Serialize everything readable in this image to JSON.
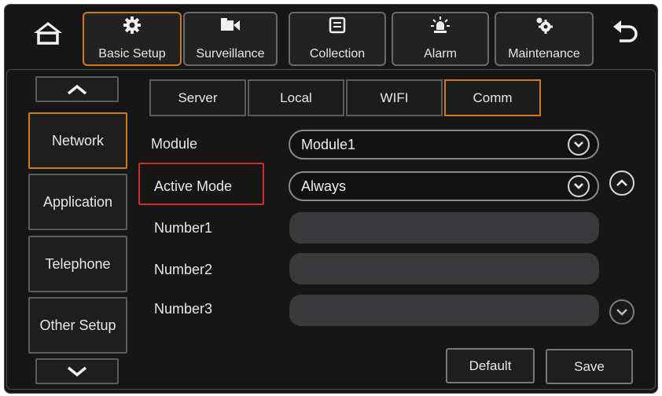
{
  "topbar": {
    "items": [
      {
        "label": "Basic Setup",
        "icon": "gear-icon",
        "active": true
      },
      {
        "label": "Surveillance",
        "icon": "camera-icon",
        "active": false
      },
      {
        "label": "Collection",
        "icon": "collection-icon",
        "active": false
      },
      {
        "label": "Alarm",
        "icon": "alarm-icon",
        "active": false
      },
      {
        "label": "Maintenance",
        "icon": "maintenance-icon",
        "active": false
      }
    ]
  },
  "sidebar": {
    "items": [
      {
        "label": "Network",
        "active": true
      },
      {
        "label": "Application",
        "active": false
      },
      {
        "label": "Telephone",
        "active": false
      },
      {
        "label": "Other Setup",
        "active": false
      }
    ]
  },
  "tabs": [
    {
      "label": "Server",
      "active": false
    },
    {
      "label": "Local",
      "active": false
    },
    {
      "label": "WIFI",
      "active": false
    },
    {
      "label": "Comm",
      "active": true
    }
  ],
  "form": {
    "module_label": "Module",
    "module_value": "Module1",
    "active_mode_label": "Active Mode",
    "active_mode_value": "Always",
    "number1_label": "Number1",
    "number1_value": "",
    "number2_label": "Number2",
    "number2_value": "",
    "number3_label": "Number3",
    "number3_value": ""
  },
  "buttons": {
    "default_label": "Default",
    "save_label": "Save"
  },
  "colors": {
    "accent": "#d07a1c",
    "highlight_red": "#d42a2a",
    "background": "#161616"
  }
}
